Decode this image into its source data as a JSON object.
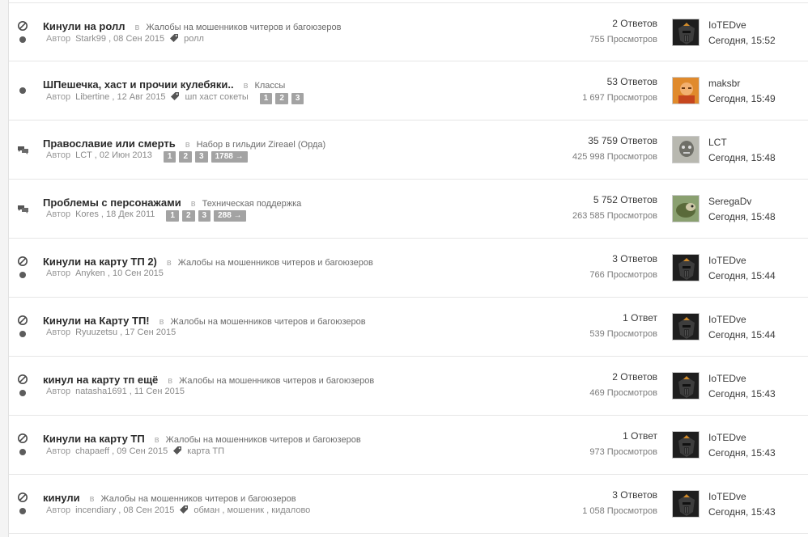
{
  "labels": {
    "in": "в",
    "author": "Автор"
  },
  "icons": {
    "locked": "no-entry-icon",
    "closed": "dot-icon",
    "hot": "speech-bubbles-icon",
    "tag": "tag-icon"
  },
  "topics": [
    {
      "title": "Кинули на ролл",
      "forum": "Жалобы на мошенников читеров и багоюзеров",
      "author": "Stark99",
      "date": ", 08 Сен 2015",
      "tags": [
        "ролл"
      ],
      "pages": [],
      "replies": "2 Ответов",
      "views": "755 Просмотров",
      "last_user": "IoTEDve",
      "last_time": "Сегодня, 15:52",
      "status": "locked",
      "avatar": "helmet"
    },
    {
      "title": "ШПешечка, хаст и прочии кулебяки..",
      "forum": "Классы",
      "author": "Libertine",
      "date": ", 12 Авг 2015",
      "tags": [
        "шп хаст сокеты"
      ],
      "pages": [
        "1",
        "2",
        "3"
      ],
      "replies": "53 Ответов",
      "views": "1 697 Просмотров",
      "last_user": "maksbr",
      "last_time": "Сегодня, 15:49",
      "status": "dot",
      "avatar": "orange"
    },
    {
      "title": "Православие или смерть",
      "forum": "Набор в гильдии Zireael (Орда)",
      "author": "LCT",
      "date": ", 02 Июн 2013",
      "tags": [],
      "pages": [
        "1",
        "2",
        "3",
        "1788 →"
      ],
      "replies": "35 759 Ответов",
      "views": "425 998 Просмотров",
      "last_user": "LCT",
      "last_time": "Сегодня, 15:48",
      "status": "hot",
      "avatar": "grey"
    },
    {
      "title": "Проблемы с персонажами",
      "forum": "Техническая поддержка",
      "author": "Kores",
      "date": ", 18 Дек 2011",
      "tags": [],
      "pages": [
        "1",
        "2",
        "3",
        "288 →"
      ],
      "replies": "5 752 Ответов",
      "views": "263 585 Просмотров",
      "last_user": "SeregaDv",
      "last_time": "Сегодня, 15:48",
      "status": "hot",
      "avatar": "green"
    },
    {
      "title": "Кинули на карту ТП 2)",
      "forum": "Жалобы на мошенников читеров и багоюзеров",
      "author": "Anyken",
      "date": ", 10 Сен 2015",
      "tags": [],
      "pages": [],
      "replies": "3 Ответов",
      "views": "766 Просмотров",
      "last_user": "IoTEDve",
      "last_time": "Сегодня, 15:44",
      "status": "locked",
      "avatar": "helmet"
    },
    {
      "title": "Кинули на Карту ТП!",
      "forum": "Жалобы на мошенников читеров и багоюзеров",
      "author": "Ryuuzetsu",
      "date": ", 17 Сен 2015",
      "tags": [],
      "pages": [],
      "replies": "1 Ответ",
      "views": "539 Просмотров",
      "last_user": "IoTEDve",
      "last_time": "Сегодня, 15:44",
      "status": "locked",
      "avatar": "helmet"
    },
    {
      "title": "кинул на карту тп ещё",
      "forum": "Жалобы на мошенников читеров и багоюзеров",
      "author": "natasha1691",
      "date": ", 11 Сен 2015",
      "tags": [],
      "pages": [],
      "replies": "2 Ответов",
      "views": "469 Просмотров",
      "last_user": "IoTEDve",
      "last_time": "Сегодня, 15:43",
      "status": "locked",
      "avatar": "helmet"
    },
    {
      "title": "Кинули на карту ТП",
      "forum": "Жалобы на мошенников читеров и багоюзеров",
      "author": "chapaeff",
      "date": ", 09 Сен 2015",
      "tags": [
        "карта ТП"
      ],
      "pages": [],
      "replies": "1 Ответ",
      "views": "973 Просмотров",
      "last_user": "IoTEDve",
      "last_time": "Сегодня, 15:43",
      "status": "locked",
      "avatar": "helmet"
    },
    {
      "title": "кинули",
      "forum": "Жалобы на мошенников читеров и багоюзеров",
      "author": "incendiary",
      "date": ", 08 Сен 2015",
      "tags": [
        "обман",
        "мошеник",
        "кидалово"
      ],
      "pages": [],
      "replies": "3 Ответов",
      "views": "1 058 Просмотров",
      "last_user": "IoTEDve",
      "last_time": "Сегодня, 15:43",
      "status": "locked",
      "avatar": "helmet"
    }
  ]
}
